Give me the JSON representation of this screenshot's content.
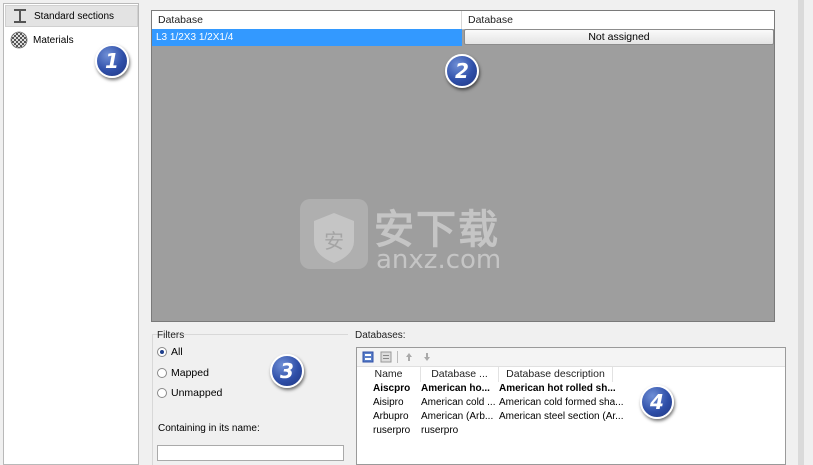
{
  "nav": {
    "items": [
      {
        "label": "Standard sections",
        "icon": "i-beam-icon",
        "selected": true
      },
      {
        "label": "Materials",
        "icon": "materials-sphere-icon",
        "selected": false
      }
    ]
  },
  "grid": {
    "columns": [
      "Database",
      "Database"
    ],
    "row": {
      "section": "L3 1/2X3 1/2X1/4",
      "assignment": "Not assigned"
    }
  },
  "watermark": {
    "text_cn": "安下载",
    "text_en": "anxz.com"
  },
  "filters": {
    "title": "Filters",
    "options": [
      {
        "label": "All",
        "selected": true
      },
      {
        "label": "Mapped",
        "selected": false
      },
      {
        "label": "Unmapped",
        "selected": false
      }
    ],
    "contain_label": "Containing in its name:",
    "contain_value": ""
  },
  "databases": {
    "title": "Databases:",
    "columns": [
      "Name",
      "Database ...",
      "Database description"
    ],
    "rows": [
      {
        "name": "Aiscpro",
        "db": "American ho...",
        "desc": "American hot rolled sh...",
        "bold": true
      },
      {
        "name": "Aisipro",
        "db": "American cold ...",
        "desc": "American cold formed sha...",
        "bold": false
      },
      {
        "name": "Arbupro",
        "db": "American (Arb...",
        "desc": "American steel section (Ar...",
        "bold": false
      },
      {
        "name": "ruserpro",
        "db": "ruserpro",
        "desc": "",
        "bold": false
      }
    ]
  },
  "badges": [
    "1",
    "2",
    "3",
    "4"
  ],
  "colors": {
    "selection": "#3399ff",
    "grid_bg": "#9e9e9e",
    "badge": "#2f4fa8"
  }
}
